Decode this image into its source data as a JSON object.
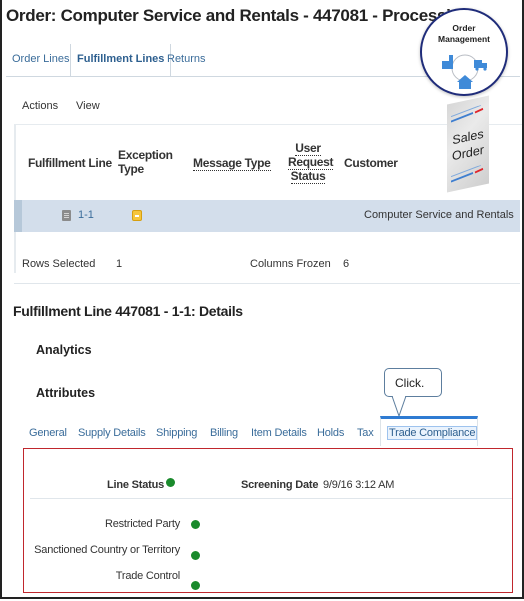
{
  "page": {
    "title": "Order: Computer Service and Rentals - 447081 - Processing"
  },
  "tabs": [
    {
      "label": "Order Lines",
      "active": false
    },
    {
      "label": "Fulfillment Lines",
      "active": true
    },
    {
      "label": "Returns",
      "active": false
    }
  ],
  "toolbar": {
    "actions_label": "Actions",
    "view_label": "View"
  },
  "table": {
    "columns": [
      {
        "label": "Fulfillment Line"
      },
      {
        "label_line1": "Exception",
        "label_line2": "Type"
      },
      {
        "label": "Message Type"
      },
      {
        "label_line1": "User",
        "label_line2": "Request",
        "label_line3": "Status"
      },
      {
        "label": "Customer"
      }
    ],
    "rows": [
      {
        "fulfillment_line": "1-1",
        "fulfillment_icon": "document-icon",
        "exception_icon": "warning-minus-icon",
        "message_type": "",
        "user_request_status": "",
        "customer": "Computer Service and Rentals"
      }
    ],
    "footer": {
      "rows_selected_label": "Rows Selected",
      "rows_selected_value": "1",
      "columns_frozen_label": "Columns Frozen",
      "columns_frozen_value": "6"
    }
  },
  "details": {
    "title": "Fulfillment Line 447081 - 1-1: Details",
    "analytics_label": "Analytics",
    "attributes_label": "Attributes",
    "tabs": [
      {
        "label": "General"
      },
      {
        "label": "Supply Details"
      },
      {
        "label": "Shipping"
      },
      {
        "label": "Billing"
      },
      {
        "label": "Item Details"
      },
      {
        "label": "Holds"
      },
      {
        "label": "Tax"
      },
      {
        "label": "Trade Compliance",
        "active": true
      }
    ],
    "trade_compliance": {
      "line_status_label": "Line Status",
      "line_status": "green",
      "screening_date_label": "Screening Date",
      "screening_date_value": "9/9/16 3:12 AM",
      "checks": [
        {
          "label": "Restricted Party",
          "status": "green"
        },
        {
          "label": "Sanctioned Country or Territory",
          "status": "green"
        },
        {
          "label": "Trade Control",
          "status": "green"
        }
      ]
    }
  },
  "callout": {
    "text": "Click."
  },
  "badges": {
    "order_management_line1": "Order",
    "order_management_line2": "Management",
    "sales_order_line1": "Sales",
    "sales_order_line2": "Order"
  },
  "colors": {
    "link": "#3a6c9a",
    "selected_row": "#d3deeb",
    "status_green": "#1a8a2c",
    "highlight_box": "#c0272d",
    "active_tab_accent": "#2f7bd2"
  }
}
